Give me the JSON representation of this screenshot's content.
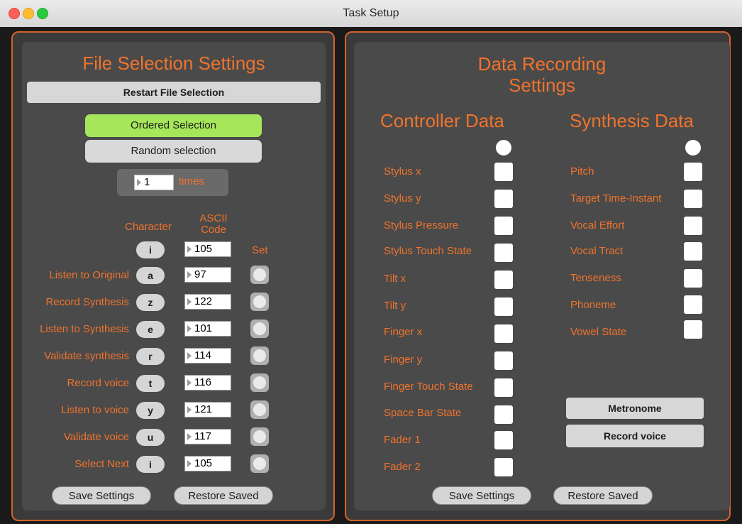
{
  "window": {
    "title": "Task Setup"
  },
  "file_selection": {
    "heading": "File Selection Settings",
    "restart_label": "Restart File Selection",
    "ordered_label": "Ordered Selection",
    "random_label": "Random selection",
    "times_value": "1",
    "times_label": "times",
    "col_character": "Character",
    "col_ascii_line1": "ASCII",
    "col_ascii_line2": "Code",
    "col_set": "Set",
    "rows": [
      {
        "label": "",
        "key": "i",
        "code": "105"
      },
      {
        "label": "Listen to Original",
        "key": "a",
        "code": "97"
      },
      {
        "label": "Record Synthesis",
        "key": "z",
        "code": "122"
      },
      {
        "label": "Listen to Synthesis",
        "key": "e",
        "code": "101"
      },
      {
        "label": "Validate synthesis",
        "key": "r",
        "code": "114"
      },
      {
        "label": "Record voice",
        "key": "t",
        "code": "116"
      },
      {
        "label": "Listen to voice",
        "key": "y",
        "code": "121"
      },
      {
        "label": "Validate voice",
        "key": "u",
        "code": "117"
      },
      {
        "label": "Select Next",
        "key": "i",
        "code": "105"
      }
    ],
    "save_label": "Save Settings",
    "restore_label": "Restore Saved"
  },
  "data_recording": {
    "heading_line1": "Data Recording",
    "heading_line2": "Settings",
    "controller_heading": "Controller Data",
    "synthesis_heading": "Synthesis Data",
    "controller_items": [
      "Stylus x",
      "Stylus y",
      "Stylus Pressure",
      "Stylus Touch State",
      "Tilt x",
      "Tilt y",
      "Finger x",
      "Finger y",
      "Finger Touch State",
      "Space Bar State",
      "Fader 1",
      "Fader 2"
    ],
    "synthesis_items": [
      "Pitch",
      "Target Time-Instant",
      "Vocal Effort",
      "Vocal Tract",
      "Tenseness",
      "Phoneme",
      "Vowel State"
    ],
    "metronome_label": "Metronome",
    "record_voice_label": "Record voice",
    "save_label": "Save Settings",
    "restore_label": "Restore Saved"
  },
  "colors": {
    "accent": "#f0732c",
    "ordered_active": "#a6e65a",
    "panel_border": "#d2642a"
  }
}
